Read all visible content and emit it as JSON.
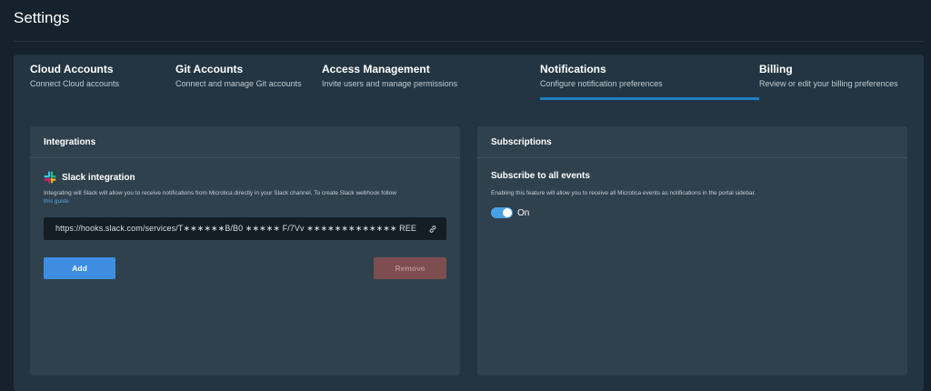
{
  "page": {
    "title": "Settings"
  },
  "tabs": [
    {
      "title": "Cloud Accounts",
      "subtitle": "Connect Cloud accounts",
      "active": false
    },
    {
      "title": "Git Accounts",
      "subtitle": "Connect and manage Git accounts",
      "active": false
    },
    {
      "title": "Access Management",
      "subtitle": "Invite users and manage permissions",
      "active": false
    },
    {
      "title": "Notifications",
      "subtitle": "Configure notification preferences",
      "active": true
    },
    {
      "title": "Billing",
      "subtitle": "Review or edit your billing preferences",
      "active": false
    }
  ],
  "integrations": {
    "header": "Integrations",
    "slack_title": "Slack integration",
    "description": "Integrating will Slack will allow you to receive notifications from Microtica directly in your Slack channel. To create Slack webhook follow",
    "guide_link": "this guide",
    "webhook_value": "https://hooks.slack.com/services/T∗∗∗∗∗∗B/B0 ∗∗∗∗∗ F/7Vv ∗∗∗∗∗∗∗∗∗∗∗∗∗ REE",
    "add_label": "Add",
    "remove_label": "Remove"
  },
  "subscriptions": {
    "header": "Subscriptions",
    "title": "Subscribe to all events",
    "description": "Enabling this feature will allow you to receive all Microtica events as notifications in the portal sidebar.",
    "toggle_label": "On",
    "toggle_on": true
  },
  "colors": {
    "accent": "#1c7fc4",
    "add_button": "#3e8de3",
    "remove_button": "#7e4d4f",
    "toggle": "#46a1e6"
  },
  "icons": {
    "slack": "slack-logo-icon",
    "link": "link-icon"
  }
}
